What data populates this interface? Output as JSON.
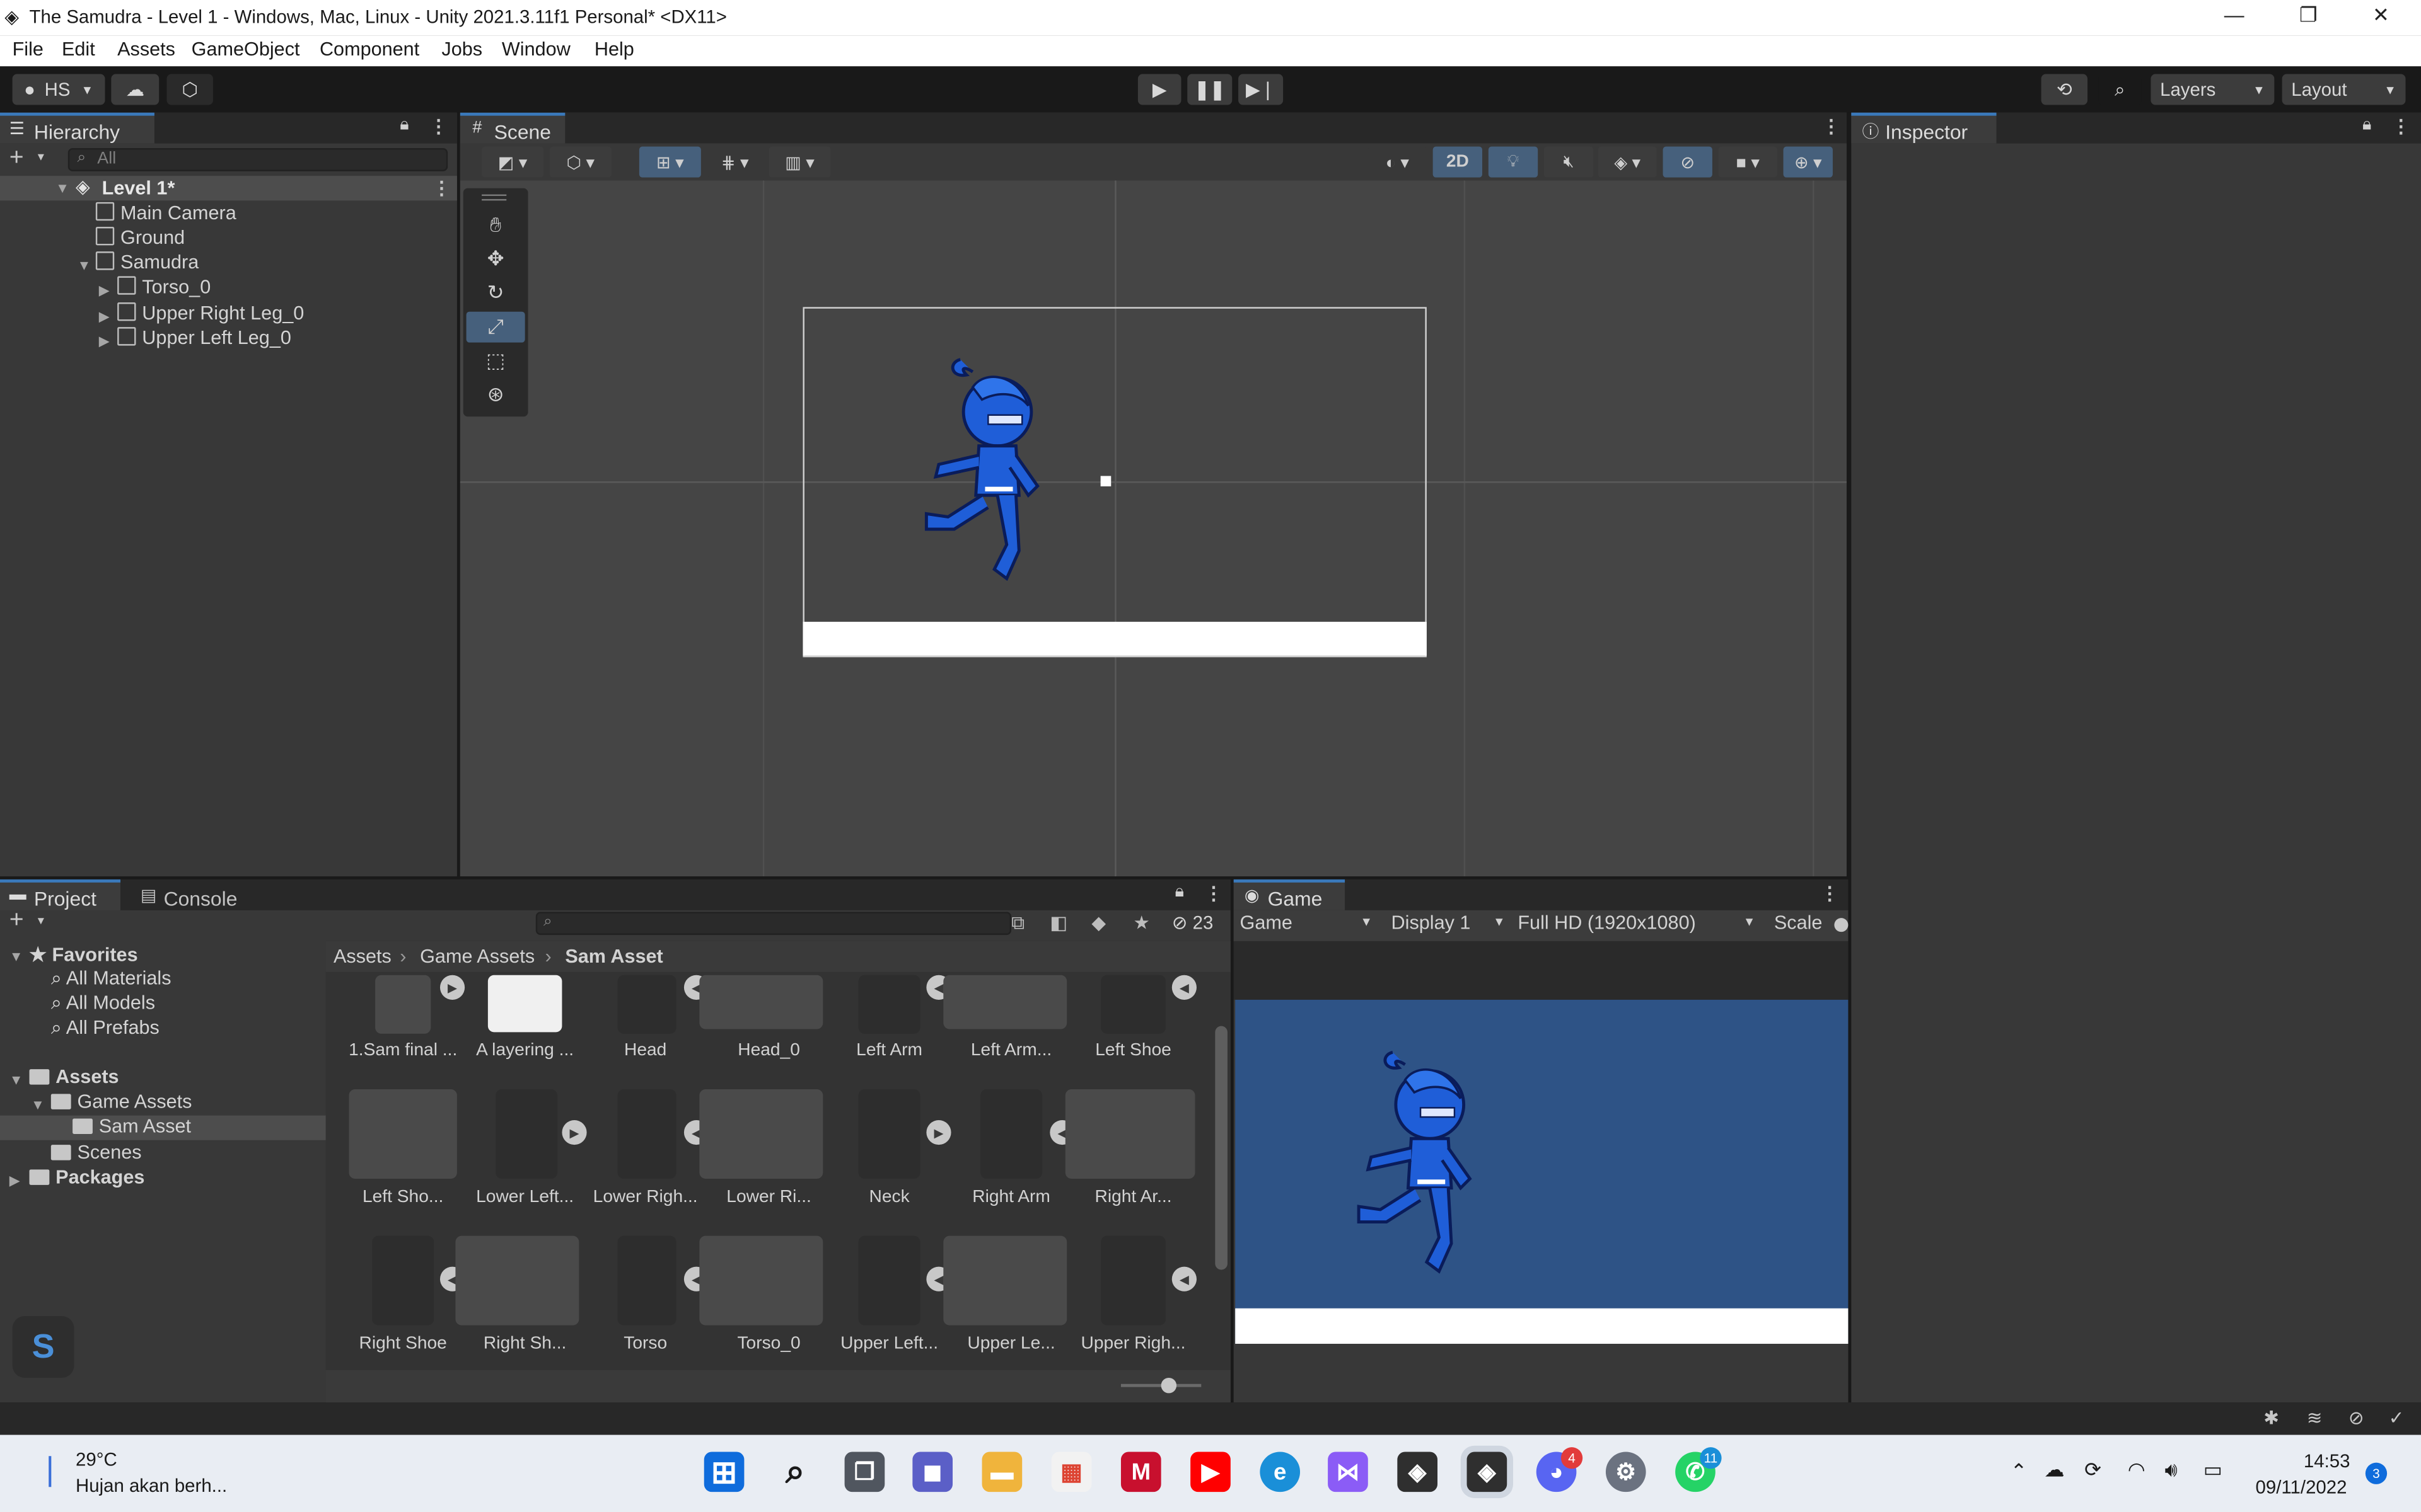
{
  "window": {
    "title": "The Samudra - Level 1 - Windows, Mac, Linux - Unity 2021.3.11f1 Personal* <DX11>",
    "controls": [
      "—",
      "❐",
      "✕"
    ]
  },
  "menu": [
    "File",
    "Edit",
    "Assets",
    "GameObject",
    "Component",
    "Jobs",
    "Window",
    "Help"
  ],
  "toolbar": {
    "account": "HS",
    "layers_label": "Layers",
    "layout_label": "Layout"
  },
  "hierarchy": {
    "tab": "Hierarchy",
    "search_placeholder": "All",
    "scene": "Level 1*",
    "items": [
      {
        "label": "Main Camera"
      },
      {
        "label": "Ground"
      },
      {
        "label": "Samudra"
      },
      {
        "label": "Torso_0"
      },
      {
        "label": "Upper Right Leg_0"
      },
      {
        "label": "Upper Left Leg_0"
      }
    ]
  },
  "scene": {
    "tab": "Scene",
    "mode_2d": "2D"
  },
  "inspector": {
    "tab": "Inspector"
  },
  "project": {
    "tab": "Project",
    "console_tab": "Console",
    "hidden_count": "23",
    "breadcrumb": [
      "Assets",
      "Game Assets",
      "Sam Asset"
    ],
    "tree": {
      "favorites": "Favorites",
      "fav_items": [
        "All Materials",
        "All Models",
        "All Prefabs"
      ],
      "assets": "Assets",
      "game_assets": "Game Assets",
      "sam_asset": "Sam Asset",
      "scenes": "Scenes",
      "packages": "Packages"
    },
    "assets_row1": [
      "1.Sam final ...",
      "A layering ...",
      "Head",
      "Head_0",
      "Left Arm",
      "Left Arm...",
      "Left Shoe"
    ],
    "assets_row2": [
      "Left Sho...",
      "Lower Left...",
      "Lower Righ...",
      "Lower Ri...",
      "Neck",
      "Right Arm",
      "Right Ar..."
    ],
    "assets_row3": [
      "Right Shoe",
      "Right Sh...",
      "Torso",
      "Torso_0",
      "Upper Left...",
      "Upper Le...",
      "Upper Righ..."
    ]
  },
  "game": {
    "tab": "Game",
    "view_select": "Game",
    "display_select": "Display 1",
    "resolution_select": "Full HD (1920x1080)",
    "scale_label": "Scale"
  },
  "taskbar": {
    "weather_temp": "29°C",
    "weather_text": "Hujan akan berh...",
    "time": "14:53",
    "date": "09/11/2022",
    "notification_count": "3",
    "discord_badge": "4",
    "whatsapp_badge": "11"
  },
  "colors": {
    "accent": "#3a79bb",
    "panel": "#383838",
    "game_bg": "#2e5386",
    "character": "#1f5ed8"
  }
}
